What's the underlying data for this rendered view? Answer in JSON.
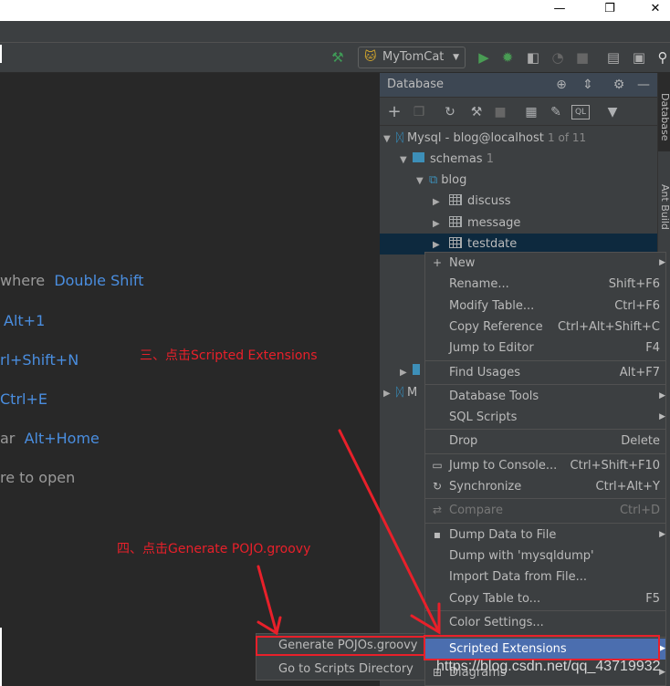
{
  "window": {
    "minimize": "—",
    "maximize": "❐",
    "close": "✕"
  },
  "toolbar": {
    "run_config": "MyTomCat",
    "icons": [
      "build-hammer-icon",
      "run-icon",
      "debug-icon",
      "coverage-icon",
      "profile-icon",
      "stop-icon",
      "project-structure-icon",
      "terminal-icon",
      "search-icon"
    ],
    "colors": {
      "run": "#499c54",
      "hammer": "#3f9b57"
    }
  },
  "editor": {
    "hints": [
      {
        "text": "where",
        "key": "Double Shift"
      },
      {
        "text": "",
        "key": "Alt+1"
      },
      {
        "text": "",
        "key": "rl+Shift+N"
      },
      {
        "text": "",
        "key": "Ctrl+E"
      },
      {
        "text": "ar",
        "key": "Alt+Home"
      },
      {
        "text": "re to open",
        "key": ""
      }
    ]
  },
  "db_panel": {
    "title": "Database",
    "tree": [
      {
        "label": "Mysql - blog@localhost",
        "badge": "1 of 11"
      },
      {
        "label": "schemas",
        "badge": "1"
      },
      {
        "label": "blog"
      },
      {
        "label": "discuss"
      },
      {
        "label": "message"
      },
      {
        "label": "testdate",
        "selected": true
      },
      {
        "label": "M"
      }
    ]
  },
  "side_tabs": [
    "Database",
    "Ant Build"
  ],
  "context_menu": {
    "items": [
      {
        "label": "New",
        "shortcut": "",
        "submenu": true,
        "icon": "plus-icon"
      },
      {
        "label": "Rename...",
        "shortcut": "Shift+F6"
      },
      {
        "label": "Modify Table...",
        "shortcut": "Ctrl+F6"
      },
      {
        "label": "Copy Reference",
        "shortcut": "Ctrl+Alt+Shift+C"
      },
      {
        "label": "Jump to Editor",
        "shortcut": "F4"
      },
      {
        "label": "Find Usages",
        "shortcut": "Alt+F7"
      },
      {
        "label": "Database Tools",
        "shortcut": "",
        "submenu": true
      },
      {
        "label": "SQL Scripts",
        "shortcut": "",
        "submenu": true
      },
      {
        "label": "Drop",
        "shortcut": "Delete"
      },
      {
        "label": "Jump to Console...",
        "shortcut": "Ctrl+Shift+F10",
        "icon": "console-icon"
      },
      {
        "label": "Synchronize",
        "shortcut": "Ctrl+Alt+Y",
        "icon": "sync-icon"
      },
      {
        "label": "Compare",
        "shortcut": "Ctrl+D",
        "disabled": true,
        "icon": "compare-icon"
      },
      {
        "label": "Dump Data to File",
        "shortcut": "",
        "submenu": true,
        "icon": "save-icon"
      },
      {
        "label": "Dump with 'mysqldump'",
        "shortcut": ""
      },
      {
        "label": "Import Data from File...",
        "shortcut": ""
      },
      {
        "label": "Copy Table to...",
        "shortcut": "F5"
      },
      {
        "label": "Color Settings...",
        "shortcut": ""
      },
      {
        "label": "Scripted Extensions",
        "shortcut": "",
        "submenu": true,
        "highlighted": true
      },
      {
        "label": "Diagrams",
        "shortcut": "",
        "submenu": true,
        "icon": "diagram-icon"
      }
    ]
  },
  "submenu": {
    "items": [
      "Generate POJOs.groovy",
      "Go to Scripts Directory"
    ]
  },
  "annotations": {
    "step3": "三、点击Scripted Extensions",
    "step4": "四、点击Generate POJO.groovy",
    "color": "#e8202a"
  },
  "watermark": "https://blog.csdn.net/qq_43719932"
}
